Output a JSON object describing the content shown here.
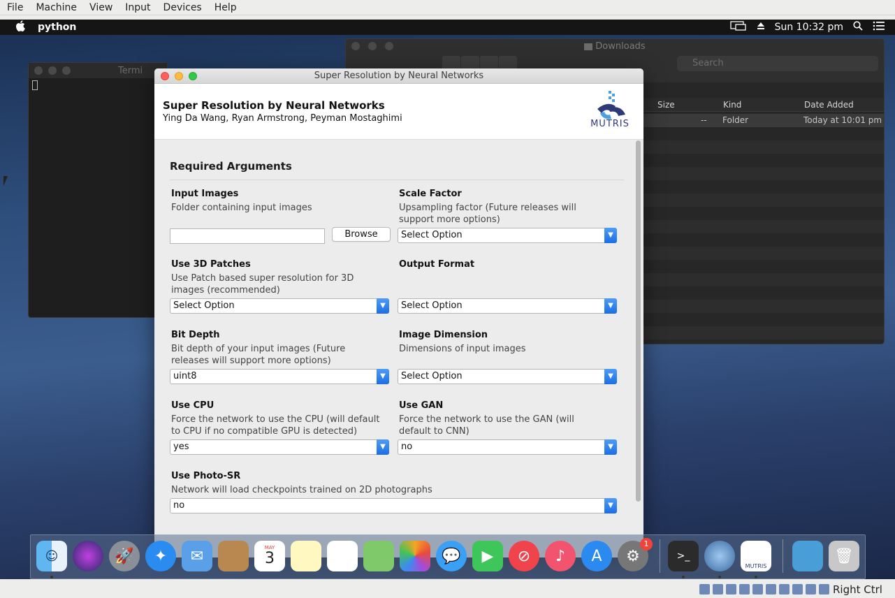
{
  "host_menu": [
    "File",
    "Machine",
    "View",
    "Input",
    "Devices",
    "Help"
  ],
  "mac_menubar": {
    "app_name": "python",
    "clock": "Sun 10:32 pm"
  },
  "terminal": {
    "title": "Termi"
  },
  "finder": {
    "title": "Downloads",
    "search_placeholder": "Search",
    "columns": [
      "Size",
      "Kind",
      "Date Added"
    ],
    "row": {
      "size": "--",
      "kind": "Folder",
      "date_added": "Today at 10:01 pm"
    }
  },
  "dialog": {
    "window_title": "Super Resolution by Neural Networks",
    "app_title": "Super Resolution by Neural Networks",
    "authors": "Ying Da Wang, Ryan Armstrong, Peyman Mostaghimi",
    "logo_text": "MUTRIS",
    "section_title": "Required Arguments",
    "fields": {
      "input_images": {
        "label": "Input Images",
        "help": "Folder containing input images",
        "value": "",
        "browse": "Browse"
      },
      "scale_factor": {
        "label": "Scale Factor",
        "help": "Upsampling factor (Future releases will support more options)",
        "value": "Select Option"
      },
      "use_3d_patches": {
        "label": "Use 3D Patches",
        "help": "Use Patch based super resolution for 3D images (recommended)",
        "value": "Select Option"
      },
      "output_format": {
        "label": "Output Format",
        "help": "",
        "value": "Select Option"
      },
      "bit_depth": {
        "label": "Bit Depth",
        "help": "Bit depth of your input images  (Future releases will support more options)",
        "value": "uint8"
      },
      "image_dimension": {
        "label": "Image Dimension",
        "help": "Dimensions of input images",
        "value": "Select Option"
      },
      "use_cpu": {
        "label": "Use CPU",
        "help": "Force the network to use the CPU (will default to CPU if no compatible GPU is detected)",
        "value": "yes"
      },
      "use_gan": {
        "label": "Use GAN",
        "help": "Force the network to use the GAN (will default to CNN)",
        "value": "no"
      },
      "use_photo_sr": {
        "label": "Use Photo-SR",
        "help": "Network will load checkpoints trained on 2D photographs",
        "value": "no"
      }
    }
  },
  "dock": {
    "apps": [
      "finder-icon",
      "siri-icon",
      "launchpad-icon",
      "safari-icon",
      "mail-icon",
      "contacts-icon",
      "calendar-icon",
      "notes-icon",
      "reminders-icon",
      "maps-icon",
      "photos-icon",
      "messages-icon",
      "facetime-icon",
      "news-icon",
      "music-icon",
      "app-store-icon",
      "system-preferences-icon",
      "terminal-icon",
      "python-launcher-icon",
      "mutris-icon",
      "downloads-folder-icon",
      "trash-icon"
    ],
    "calendar_month": "MAY",
    "calendar_day": "3",
    "badge_count": "1",
    "mutris_label": "MUTRIS"
  },
  "host_statusbar": {
    "host_key": "Right Ctrl"
  }
}
